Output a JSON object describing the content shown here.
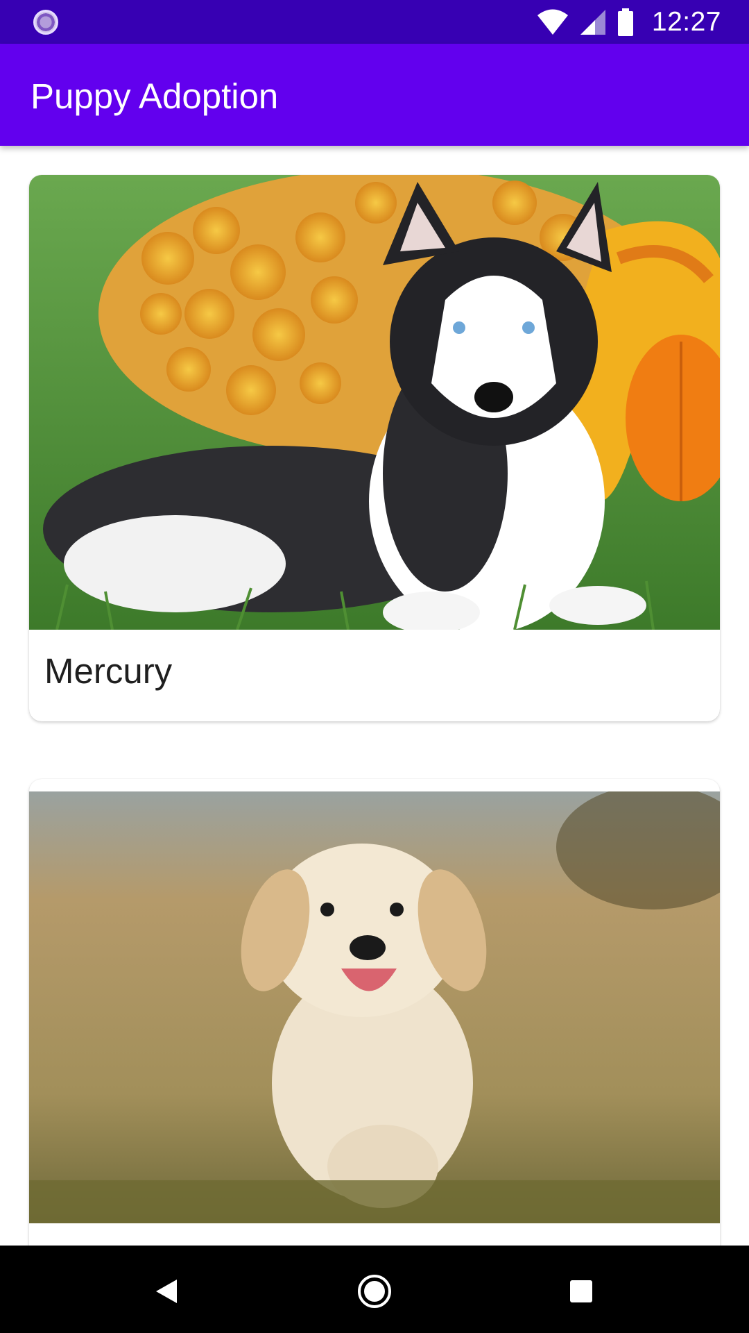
{
  "status_bar": {
    "time": "12:27",
    "icons": [
      "loading-indicator-icon",
      "wifi-icon",
      "cell-signal-icon",
      "battery-icon"
    ]
  },
  "app_bar": {
    "title": "Puppy Adoption",
    "color": "#6200ee",
    "status_color": "#3700b3"
  },
  "puppies": [
    {
      "name": "Mercury",
      "photo": "husky-puppy-photo"
    },
    {
      "name": "",
      "photo": "golden-retriever-puppy-photo"
    }
  ],
  "nav_bar": {
    "icons": [
      "back-icon",
      "home-icon",
      "recents-icon"
    ]
  }
}
